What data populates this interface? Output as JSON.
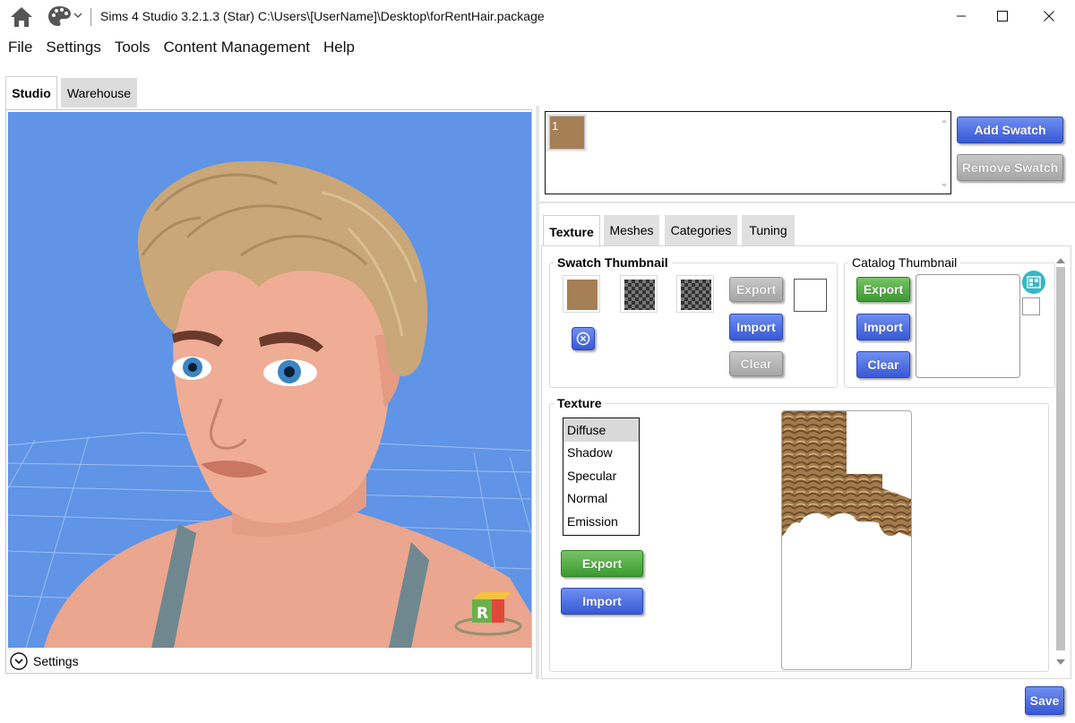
{
  "window": {
    "title": "Sims 4 Studio 3.2.1.3 (Star)  C:\\Users\\[UserName]\\Desktop\\forRentHair.package"
  },
  "menu": [
    "File",
    "Settings",
    "Tools",
    "Content Management",
    "Help"
  ],
  "main_tabs": {
    "studio": "Studio",
    "warehouse": "Warehouse"
  },
  "viewport": {
    "settings_label": "Settings",
    "bg_color": "#5f94e6",
    "logo_letter": "R"
  },
  "swatches": {
    "items": [
      {
        "label": "1",
        "color": "#a57f55"
      }
    ],
    "add_label": "Add Swatch",
    "remove_label": "Remove Swatch"
  },
  "inner_tabs": [
    "Texture",
    "Meshes",
    "Categories",
    "Tuning"
  ],
  "swatch_thumbnail": {
    "title": "Swatch Thumbnail",
    "export_label": "Export",
    "import_label": "Import",
    "clear_label": "Clear"
  },
  "catalog_thumbnail": {
    "title": "Catalog Thumbnail",
    "export_label": "Export",
    "import_label": "Import",
    "clear_label": "Clear"
  },
  "texture": {
    "title": "Texture",
    "channels": [
      "Diffuse",
      "Shadow",
      "Specular",
      "Normal",
      "Emission"
    ],
    "selected": "Diffuse",
    "export_label": "Export",
    "import_label": "Import"
  },
  "footer": {
    "save_label": "Save"
  },
  "colors": {
    "blue_button": "#4a6ae0",
    "green_button": "#52ad44",
    "hair": "#a57f55"
  }
}
